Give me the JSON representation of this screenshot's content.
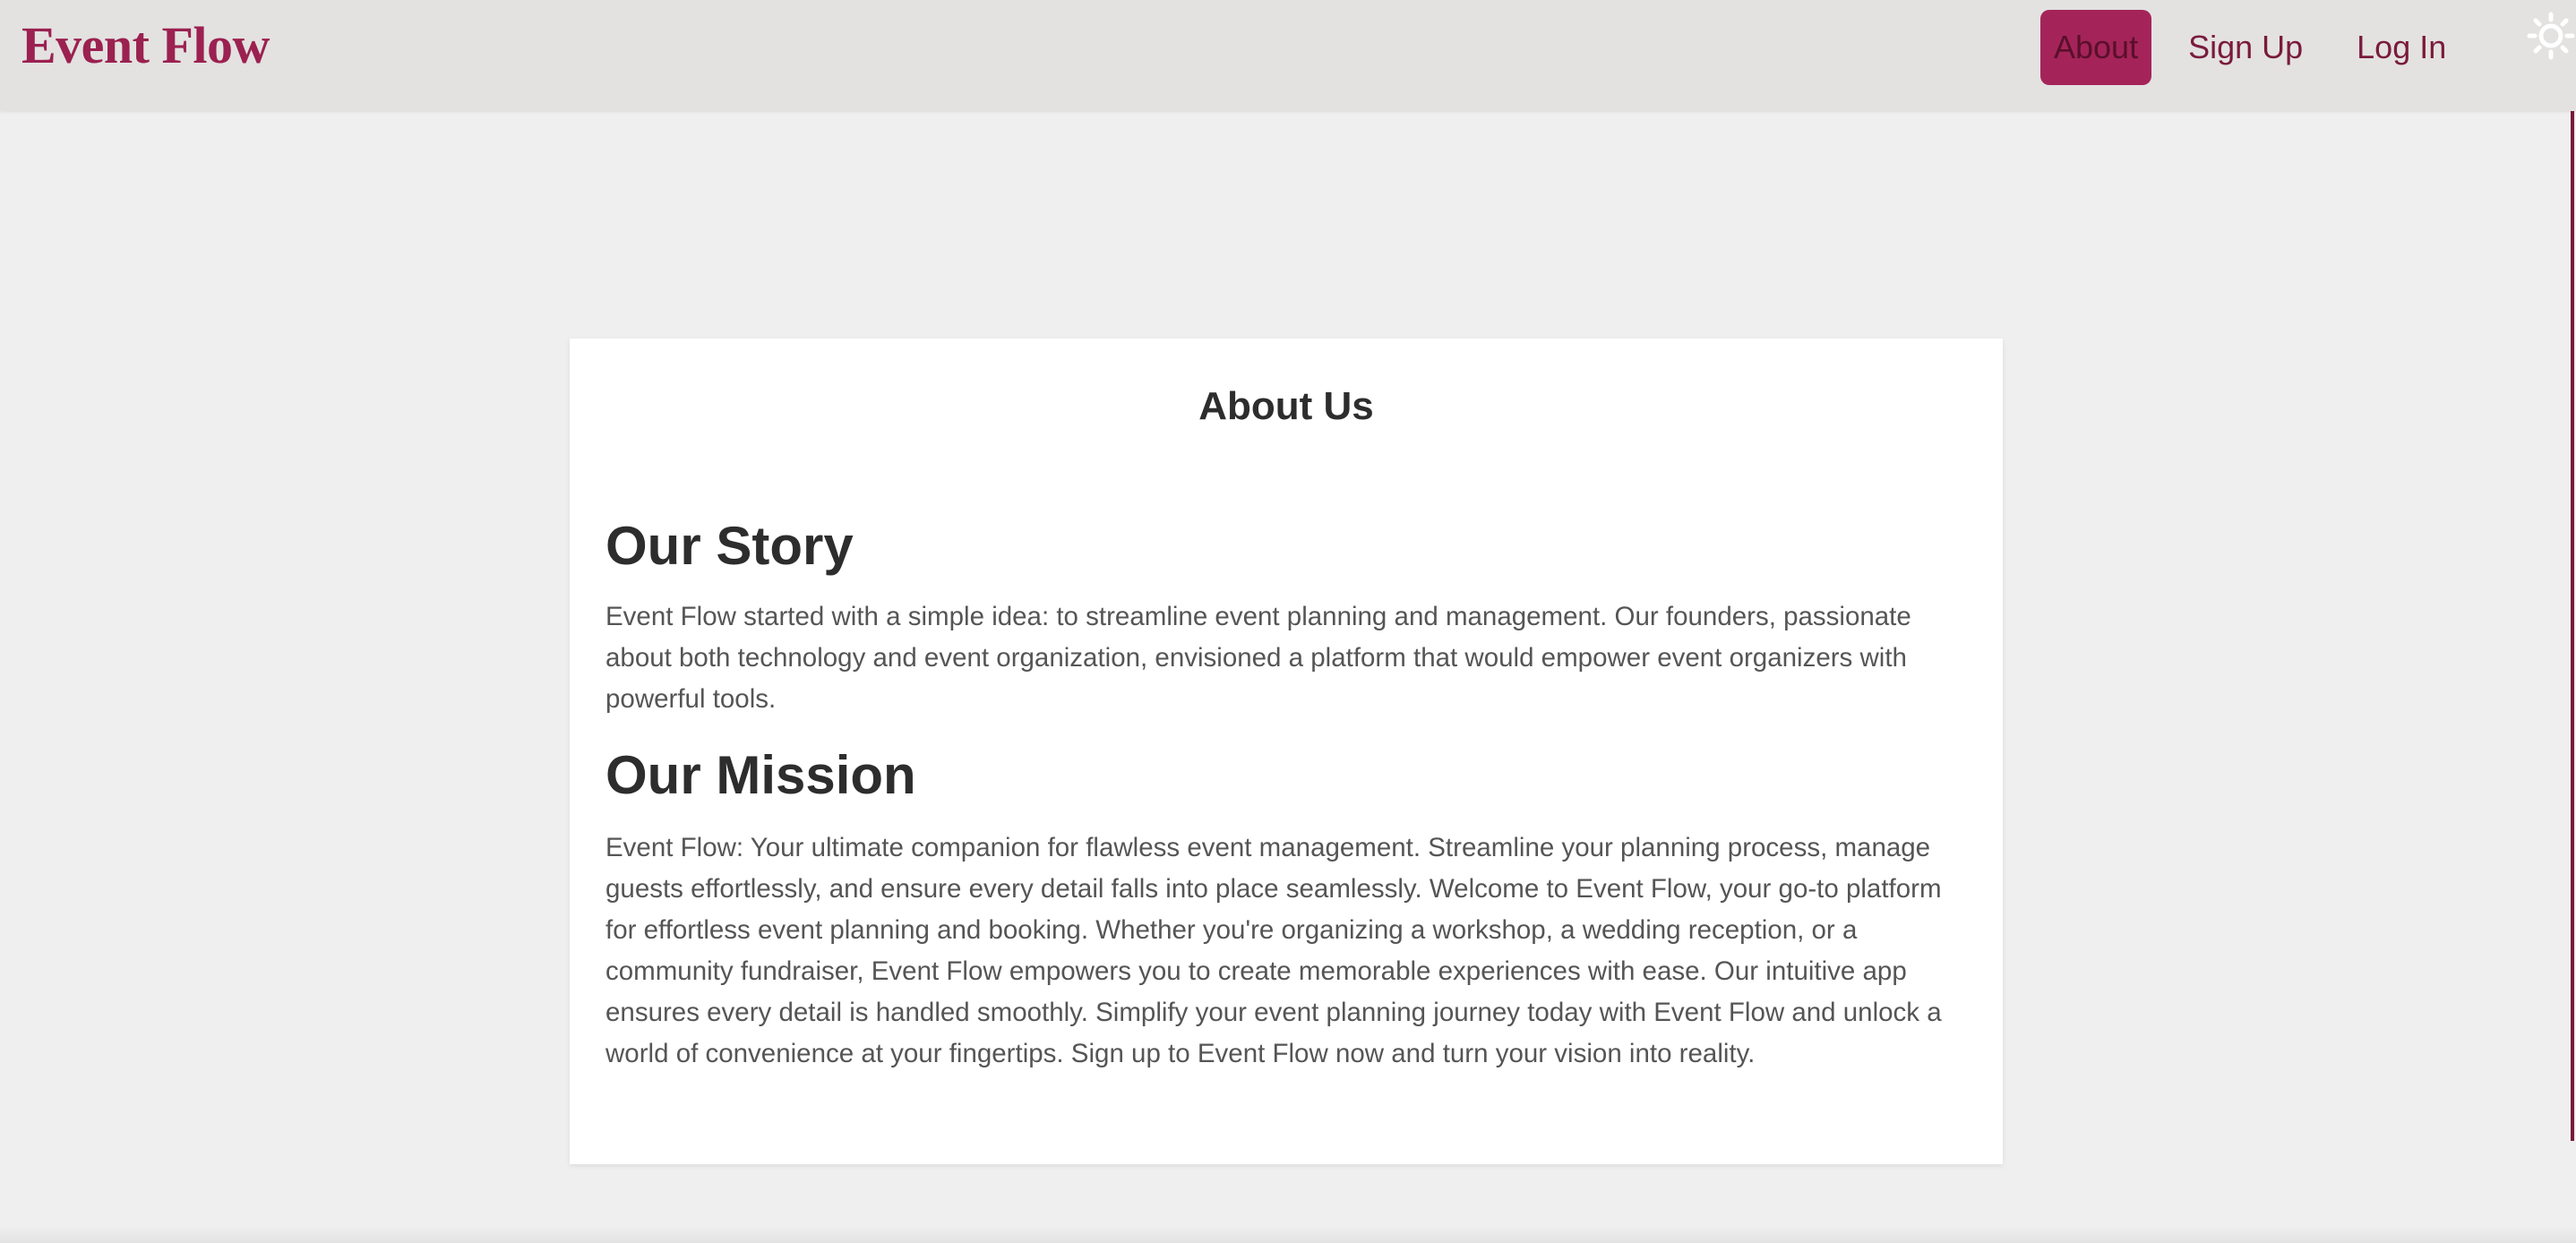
{
  "brand": {
    "name": "Event Flow",
    "color": "#9b2150"
  },
  "nav": {
    "items": [
      {
        "label": "About",
        "active": true
      },
      {
        "label": "Sign Up",
        "active": false
      },
      {
        "label": "Log In",
        "active": false
      }
    ],
    "accent_color": "#a42459",
    "theme_toggle_icon": "sun-icon"
  },
  "page": {
    "title": "About Us",
    "sections": [
      {
        "heading": "Our Story",
        "text": "Event Flow started with a simple idea: to streamline event planning and management. Our founders, passionate about both technology and event organization, envisioned a platform that would empower event organizers with powerful tools."
      },
      {
        "heading": "Our Mission",
        "text": "Event Flow: Your ultimate companion for flawless event management. Streamline your planning process, manage guests effortlessly, and ensure every detail falls into place seamlessly. Welcome to Event Flow, your go-to platform for effortless event planning and booking. Whether you're organizing a workshop, a wedding reception, or a community fundraiser, Event Flow empowers you to create memorable experiences with ease. Our intuitive app ensures every detail is handled smoothly. Simplify your event planning journey today with Event Flow and unlock a world of convenience at your fingertips. Sign up to Event Flow now and turn your vision into reality."
      }
    ]
  }
}
